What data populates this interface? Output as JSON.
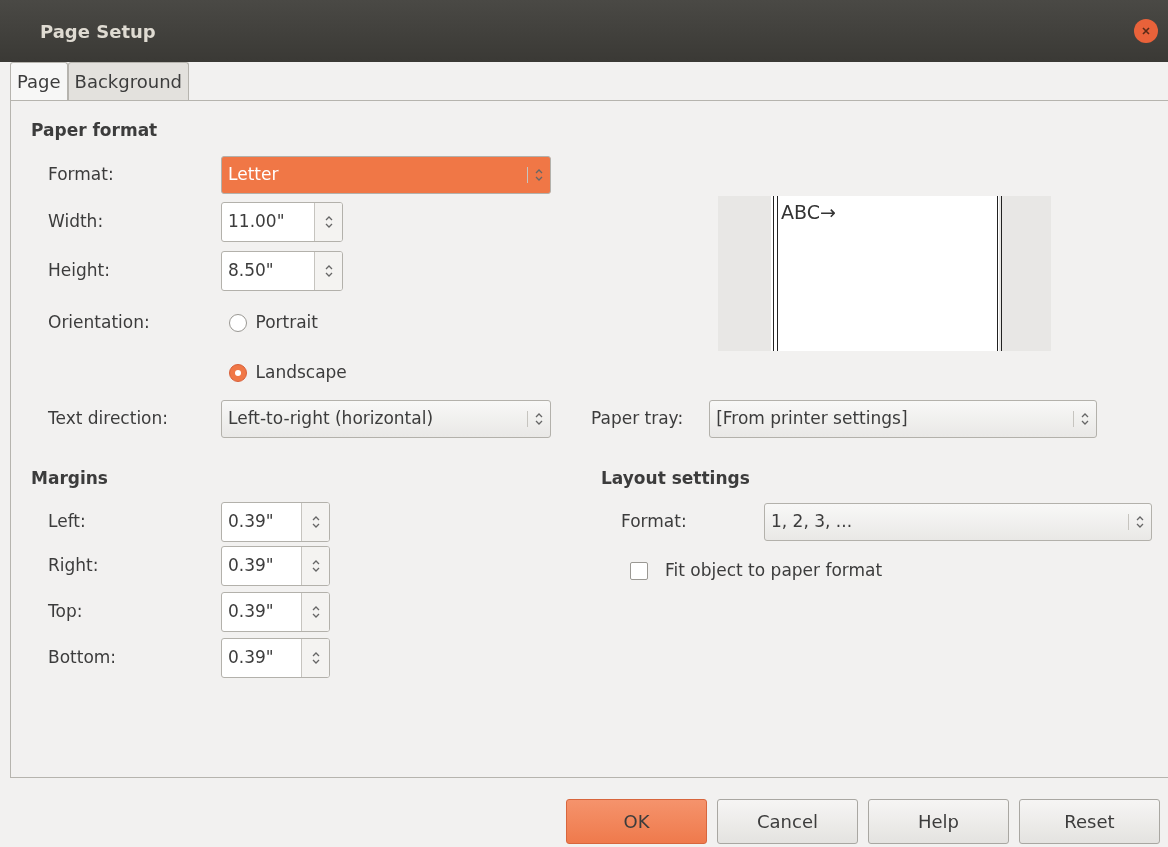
{
  "window": {
    "title": "Page Setup"
  },
  "tabs": [
    {
      "label": "Page",
      "selected": true
    },
    {
      "label": "Background",
      "selected": false
    }
  ],
  "paper_format": {
    "heading": "Paper format",
    "format": {
      "label": "Format:",
      "value": "Letter",
      "focused": true
    },
    "width": {
      "label": "Width:",
      "value": "11.00\""
    },
    "height": {
      "label": "Height:",
      "value": "8.50\""
    },
    "orientation": {
      "label": "Orientation:",
      "options": [
        {
          "label": "Portrait",
          "selected": false
        },
        {
          "label": "Landscape",
          "selected": true
        }
      ]
    },
    "text_direction": {
      "label": "Text direction:",
      "value": "Left-to-right (horizontal)"
    },
    "paper_tray": {
      "label": "Paper tray:",
      "value": "[From printer settings]"
    },
    "preview": {
      "text": "ABC→"
    }
  },
  "margins": {
    "heading": "Margins",
    "fields": [
      {
        "label": "Left:",
        "value": "0.39\""
      },
      {
        "label": "Right:",
        "value": "0.39\""
      },
      {
        "label": "Top:",
        "value": "0.39\""
      },
      {
        "label": "Bottom:",
        "value": "0.39\""
      }
    ]
  },
  "layout_settings": {
    "heading": "Layout settings",
    "format": {
      "label": "Format:",
      "value": "1, 2, 3, ..."
    },
    "fit_object": {
      "label": "Fit object to paper format",
      "checked": false
    }
  },
  "buttons": [
    {
      "label": "OK",
      "default": true
    },
    {
      "label": "Cancel",
      "default": false
    },
    {
      "label": "Help",
      "default": false
    },
    {
      "label": "Reset",
      "default": false
    }
  ]
}
